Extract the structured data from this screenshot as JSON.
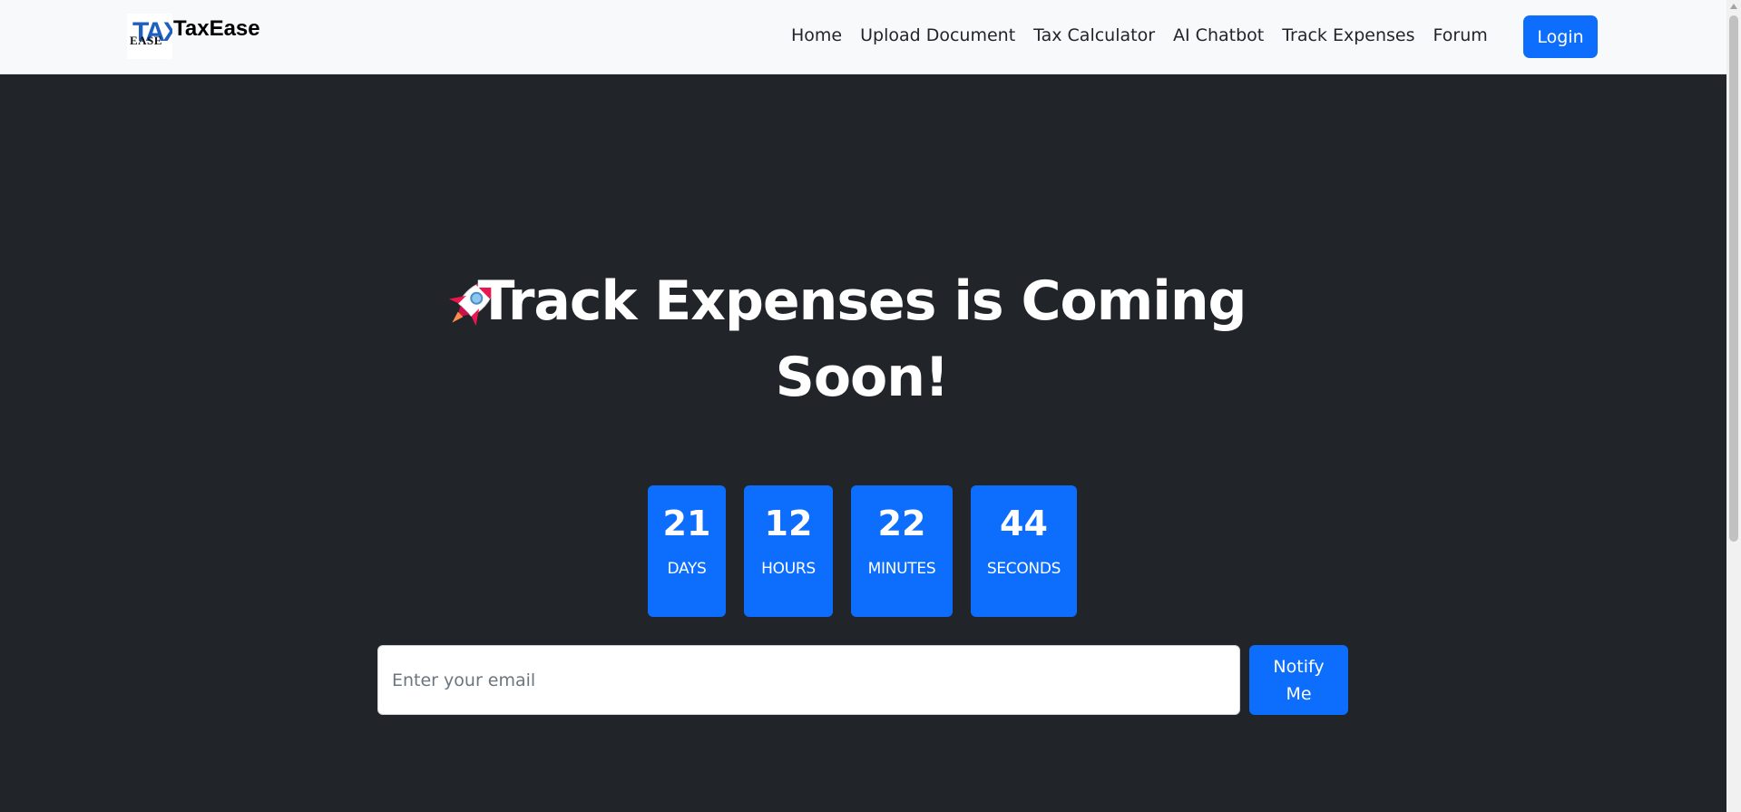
{
  "brand": {
    "logo_text_top": "TAX",
    "logo_text_bottom": "EASE",
    "name": "TaxEase"
  },
  "nav": {
    "items": [
      {
        "label": "Home"
      },
      {
        "label": "Upload Document"
      },
      {
        "label": "Tax Calculator"
      },
      {
        "label": "AI Chatbot"
      },
      {
        "label": "Track Expenses"
      },
      {
        "label": "Forum"
      }
    ],
    "login_label": "Login"
  },
  "hero": {
    "icon": "rocket-icon",
    "title": "Track Expenses is Coming Soon!"
  },
  "countdown": [
    {
      "value": "21",
      "label": "DAYS"
    },
    {
      "value": "12",
      "label": "HOURS"
    },
    {
      "value": "22",
      "label": "MINUTES"
    },
    {
      "value": "44",
      "label": "SECONDS"
    }
  ],
  "subscribe": {
    "placeholder": "Enter your email",
    "button_label": "Notify Me"
  },
  "colors": {
    "primary": "#0d6efd",
    "background": "#212529",
    "navbar": "#f8f9fa"
  }
}
